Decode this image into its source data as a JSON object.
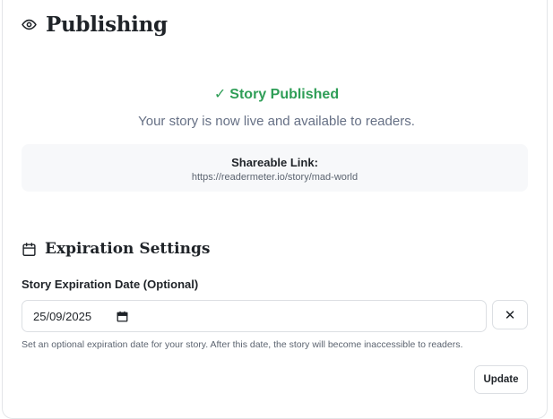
{
  "header": {
    "title": "Publishing",
    "icon": "eye-icon"
  },
  "status": {
    "title": "Story Published",
    "check_glyph": "✓",
    "color": "#2f9e57",
    "subtitle": "Your story is now live and available to readers."
  },
  "share": {
    "label": "Shareable Link:",
    "url": "https://readermeter.io/story/mad-world"
  },
  "expiration": {
    "title": "Expiration Settings",
    "icon": "calendar-icon",
    "field_label": "Story Expiration Date (Optional)",
    "date_value": "25/09/2025",
    "clear_glyph": "✕",
    "help_text": "Set an optional expiration date for your story. After this date, the story will become inaccessible to readers.",
    "update_label": "Update"
  }
}
